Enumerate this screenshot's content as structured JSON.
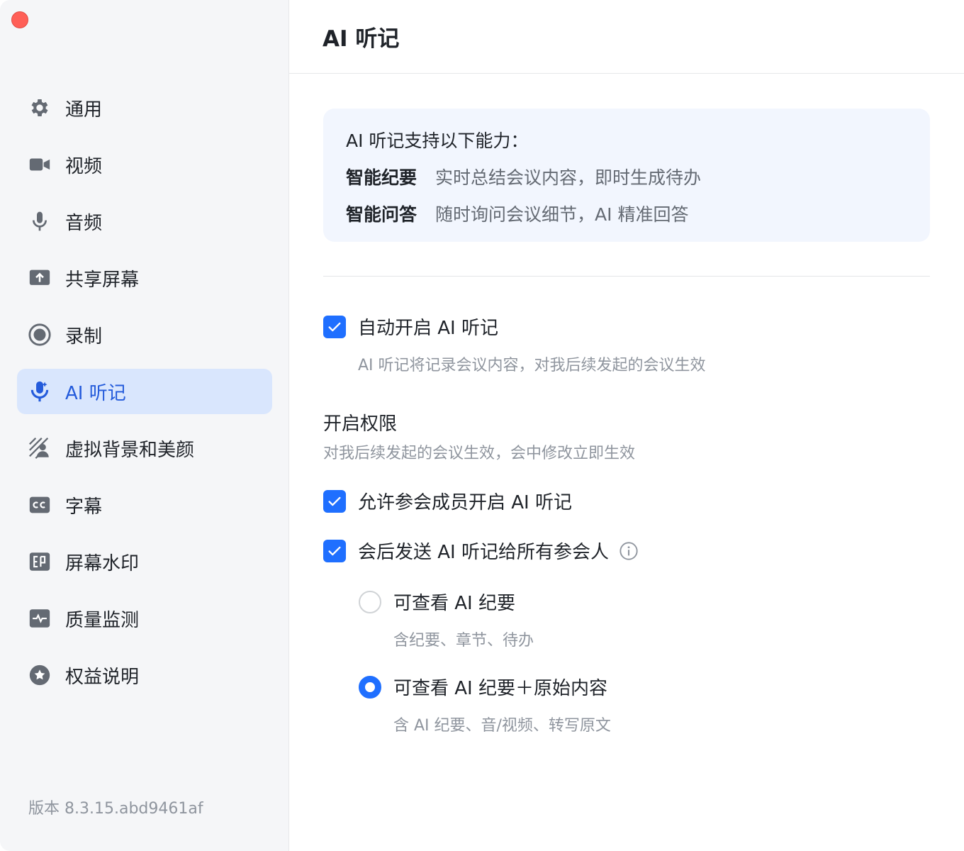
{
  "sidebar": {
    "items": [
      {
        "label": "通用",
        "icon": "gear-icon"
      },
      {
        "label": "视频",
        "icon": "video-camera-icon"
      },
      {
        "label": "音频",
        "icon": "microphone-icon"
      },
      {
        "label": "共享屏幕",
        "icon": "share-screen-icon"
      },
      {
        "label": "录制",
        "icon": "record-icon"
      },
      {
        "label": "AI 听记",
        "icon": "ai-notes-icon",
        "active": true
      },
      {
        "label": "虚拟背景和美颜",
        "icon": "virtual-background-icon"
      },
      {
        "label": "字幕",
        "icon": "captions-icon"
      },
      {
        "label": "屏幕水印",
        "icon": "watermark-icon"
      },
      {
        "label": "质量监测",
        "icon": "quality-monitor-icon"
      },
      {
        "label": "权益说明",
        "icon": "star-badge-icon"
      }
    ],
    "version": "版本 8.3.15.abd9461af"
  },
  "main": {
    "title": "AI 听记",
    "info": {
      "title": "AI 听记支持以下能力：",
      "rows": [
        {
          "key": "智能纪要",
          "value": "实时总结会议内容，即时生成待办"
        },
        {
          "key": "智能问答",
          "value": "随时询问会议细节，AI 精准回答"
        }
      ]
    },
    "auto_start": {
      "label": "自动开启 AI 听记",
      "checked": true,
      "hint": "AI 听记将记录会议内容，对我后续发起的会议生效"
    },
    "permissions": {
      "title": "开启权限",
      "hint": "对我后续发起的会议生效，会中修改立即生效",
      "allow_members": {
        "label": "允许参会成员开启 AI 听记",
        "checked": true
      },
      "send_after": {
        "label": "会后发送 AI 听记给所有参会人",
        "checked": true
      },
      "options": [
        {
          "label": "可查看 AI 纪要",
          "hint": "含纪要、章节、待办",
          "selected": false
        },
        {
          "label": "可查看 AI 纪要＋原始内容",
          "hint": "含 AI 纪要、音/视频、转写原文",
          "selected": true
        }
      ]
    }
  },
  "colors": {
    "accent": "#1f6fff",
    "active_bg": "#d9e6fd",
    "active_text": "#245bdb"
  }
}
